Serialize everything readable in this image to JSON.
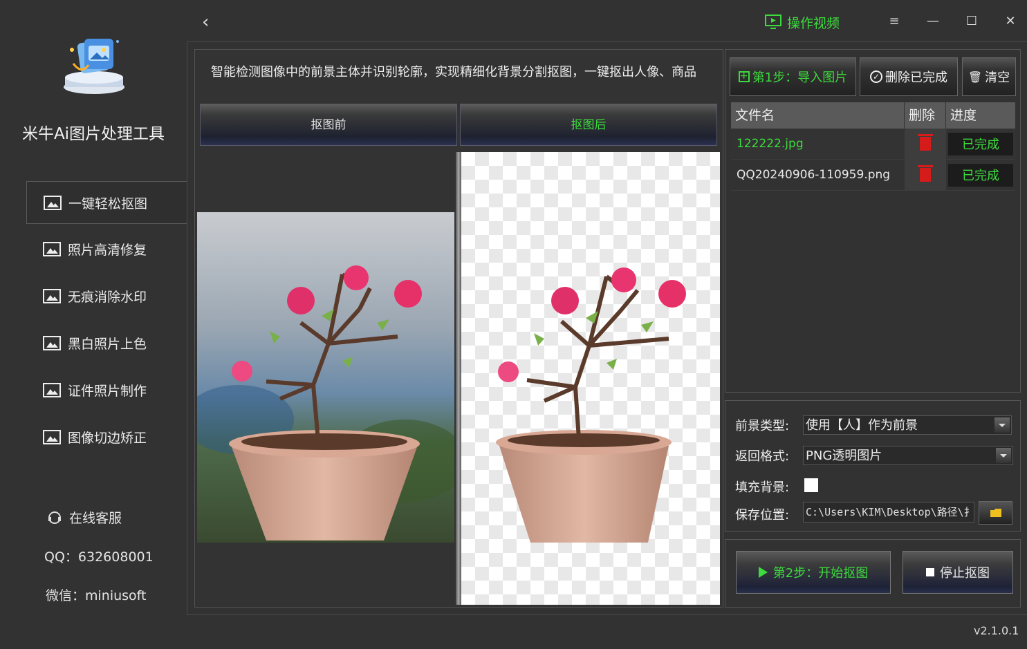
{
  "window": {
    "back_icon": "chevron-left-icon",
    "video_label": "操作视频",
    "accent": "#3ddc3d",
    "menu_icon": "≡",
    "minimize_icon": "—",
    "maximize_icon": "☐",
    "close_icon": "✕"
  },
  "sidebar": {
    "app_name": "米牛Ai图片处理工具",
    "items": [
      {
        "label": "一键轻松抠图",
        "active": true
      },
      {
        "label": "照片高清修复"
      },
      {
        "label": "无痕消除水印"
      },
      {
        "label": "黑白照片上色"
      },
      {
        "label": "证件照片制作"
      },
      {
        "label": "图像切边矫正"
      }
    ],
    "support_label": "在线客服",
    "qq": "QQ：632608001",
    "wechat": "微信：miniusoft"
  },
  "main": {
    "description": "智能检测图像中的前景主体并识别轮廓，实现精细化背景分割抠图，一键抠出人像、商品",
    "tab_before": "抠图前",
    "tab_after": "抠图后"
  },
  "right": {
    "import_button": "第1步：导入图片",
    "delete_done_button": "删除已完成",
    "clear_button": "清空",
    "table": {
      "headers": [
        "文件名",
        "删除",
        "进度"
      ],
      "rows": [
        {
          "filename": "122222.jpg",
          "progress": "已完成",
          "selected": true
        },
        {
          "filename": "QQ20240906-110959.png",
          "progress": "已完成"
        }
      ]
    },
    "settings": {
      "foreground_label": "前景类型:",
      "foreground_value": "使用【人】作为前景",
      "format_label": "返回格式:",
      "format_value": "PNG透明图片",
      "fill_label": "填充背景:",
      "save_label": "保存位置:",
      "save_path": "C:\\Users\\KIM\\Desktop\\路径\\扌"
    },
    "start_button": "第2步：开始抠图",
    "stop_button": "停止抠图"
  },
  "version": "v2.1.0.1"
}
